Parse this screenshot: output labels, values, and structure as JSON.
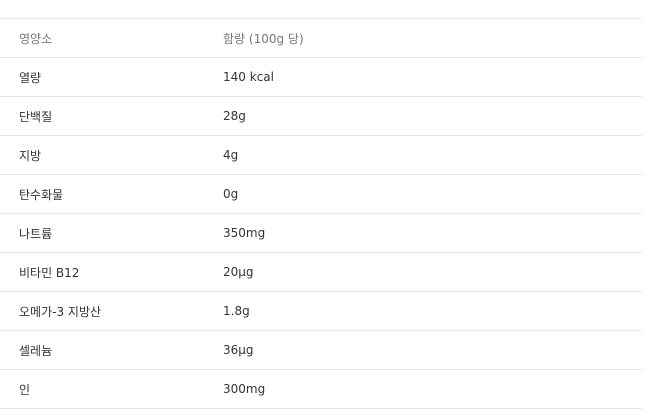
{
  "table": {
    "header": {
      "nutrient": "영양소",
      "amount": "함량 (100g 당)"
    },
    "rows": [
      {
        "nutrient": "열량",
        "amount": "140 kcal"
      },
      {
        "nutrient": "단백질",
        "amount": "28g"
      },
      {
        "nutrient": "지방",
        "amount": "4g"
      },
      {
        "nutrient": "탄수화물",
        "amount": "0g"
      },
      {
        "nutrient": "나트륨",
        "amount": "350mg"
      },
      {
        "nutrient": "비타민 B12",
        "amount": "20μg"
      },
      {
        "nutrient": "오메가-3 지방산",
        "amount": "1.8g"
      },
      {
        "nutrient": "셀레늄",
        "amount": "36μg"
      },
      {
        "nutrient": "인",
        "amount": "300mg"
      }
    ]
  }
}
